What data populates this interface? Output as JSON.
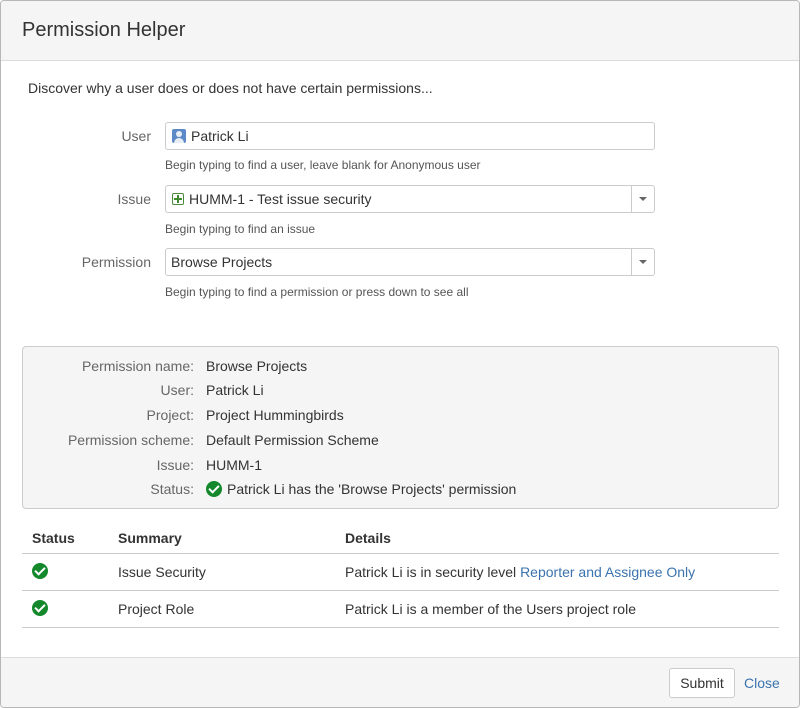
{
  "dialog": {
    "title": "Permission Helper",
    "intro": "Discover why a user does or does not have certain permissions..."
  },
  "form": {
    "user": {
      "label": "User",
      "value": "Patrick Li",
      "hint": "Begin typing to find a user, leave blank for Anonymous user"
    },
    "issue": {
      "label": "Issue",
      "value": "HUMM-1 - Test issue security",
      "hint": "Begin typing to find an issue"
    },
    "permission": {
      "label": "Permission",
      "value": "Browse Projects",
      "hint": "Begin typing to find a permission or press down to see all"
    }
  },
  "summary": {
    "permission_name": {
      "label": "Permission name:",
      "value": "Browse Projects"
    },
    "user": {
      "label": "User:",
      "value": "Patrick Li"
    },
    "project": {
      "label": "Project:",
      "value": "Project Hummingbirds"
    },
    "scheme": {
      "label": "Permission scheme:",
      "value": "Default Permission Scheme"
    },
    "issue": {
      "label": "Issue:",
      "value": "HUMM-1"
    },
    "status": {
      "label": "Status:",
      "value": "Patrick Li has the 'Browse Projects' permission"
    }
  },
  "table": {
    "headers": [
      "Status",
      "Summary",
      "Details"
    ],
    "rows": [
      {
        "summary": "Issue Security",
        "details": "Patrick Li is in security level ",
        "details_link": "Reporter and Assignee Only"
      },
      {
        "summary": "Project Role",
        "details": "Patrick Li is a member of the Users project role"
      }
    ]
  },
  "footer": {
    "submit": "Submit",
    "close": "Close"
  },
  "colors": {
    "link": "#3b73af",
    "success": "#14892c"
  }
}
